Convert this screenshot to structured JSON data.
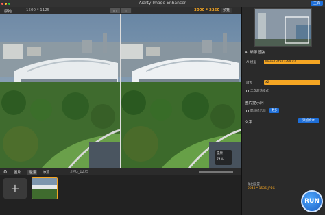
{
  "window": {
    "title": "Aiarty Image Enhancer",
    "top_button": "主頁"
  },
  "toolbar": {
    "left": "原始",
    "size": "1500 * 1125",
    "output_size": "3000 * 2250",
    "compare": "預覽",
    "toggle": [
      "▯▯",
      "▯"
    ]
  },
  "zoom": {
    "label": "還原",
    "value": "74%"
  },
  "bottombar": {
    "tabs": [
      "圖片",
      "過濾",
      "添加"
    ],
    "file": "/IMG_1275"
  },
  "filmstrip": {
    "add": "+"
  },
  "sidebar": {
    "ai_section": "AI 細節增強",
    "ai_model_label": "AI 模型",
    "ai_model_value": "More-Detail GAN v2",
    "scale_label": "放大",
    "scale_value": "x2",
    "scale_option": "二次超清模式",
    "extract_section": "圖片提示詞",
    "extract_label": "開啟提示詞",
    "extract_btn": "更多",
    "text_section": "文字",
    "text_btn": "添加文本",
    "export_label": "輸出設置",
    "export_value": "2048 * 1536 JPEG",
    "run": "RUN"
  },
  "colors": {
    "accent": "#f5a623",
    "blue": "#1e6fd9"
  }
}
